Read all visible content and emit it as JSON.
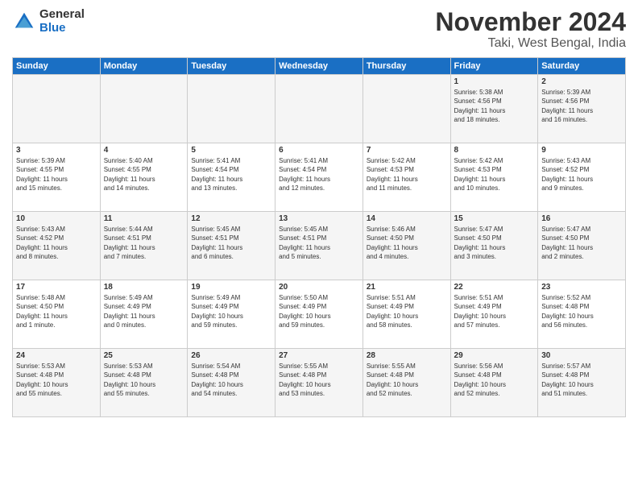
{
  "header": {
    "logo_general": "General",
    "logo_blue": "Blue",
    "month": "November 2024",
    "location": "Taki, West Bengal, India"
  },
  "days_of_week": [
    "Sunday",
    "Monday",
    "Tuesday",
    "Wednesday",
    "Thursday",
    "Friday",
    "Saturday"
  ],
  "weeks": [
    {
      "cells": [
        {
          "day": null,
          "info": null
        },
        {
          "day": null,
          "info": null
        },
        {
          "day": null,
          "info": null
        },
        {
          "day": null,
          "info": null
        },
        {
          "day": null,
          "info": null
        },
        {
          "day": "1",
          "info": "Sunrise: 5:38 AM\nSunset: 4:56 PM\nDaylight: 11 hours\nand 18 minutes."
        },
        {
          "day": "2",
          "info": "Sunrise: 5:39 AM\nSunset: 4:56 PM\nDaylight: 11 hours\nand 16 minutes."
        }
      ]
    },
    {
      "cells": [
        {
          "day": "3",
          "info": "Sunrise: 5:39 AM\nSunset: 4:55 PM\nDaylight: 11 hours\nand 15 minutes."
        },
        {
          "day": "4",
          "info": "Sunrise: 5:40 AM\nSunset: 4:55 PM\nDaylight: 11 hours\nand 14 minutes."
        },
        {
          "day": "5",
          "info": "Sunrise: 5:41 AM\nSunset: 4:54 PM\nDaylight: 11 hours\nand 13 minutes."
        },
        {
          "day": "6",
          "info": "Sunrise: 5:41 AM\nSunset: 4:54 PM\nDaylight: 11 hours\nand 12 minutes."
        },
        {
          "day": "7",
          "info": "Sunrise: 5:42 AM\nSunset: 4:53 PM\nDaylight: 11 hours\nand 11 minutes."
        },
        {
          "day": "8",
          "info": "Sunrise: 5:42 AM\nSunset: 4:53 PM\nDaylight: 11 hours\nand 10 minutes."
        },
        {
          "day": "9",
          "info": "Sunrise: 5:43 AM\nSunset: 4:52 PM\nDaylight: 11 hours\nand 9 minutes."
        }
      ]
    },
    {
      "cells": [
        {
          "day": "10",
          "info": "Sunrise: 5:43 AM\nSunset: 4:52 PM\nDaylight: 11 hours\nand 8 minutes."
        },
        {
          "day": "11",
          "info": "Sunrise: 5:44 AM\nSunset: 4:51 PM\nDaylight: 11 hours\nand 7 minutes."
        },
        {
          "day": "12",
          "info": "Sunrise: 5:45 AM\nSunset: 4:51 PM\nDaylight: 11 hours\nand 6 minutes."
        },
        {
          "day": "13",
          "info": "Sunrise: 5:45 AM\nSunset: 4:51 PM\nDaylight: 11 hours\nand 5 minutes."
        },
        {
          "day": "14",
          "info": "Sunrise: 5:46 AM\nSunset: 4:50 PM\nDaylight: 11 hours\nand 4 minutes."
        },
        {
          "day": "15",
          "info": "Sunrise: 5:47 AM\nSunset: 4:50 PM\nDaylight: 11 hours\nand 3 minutes."
        },
        {
          "day": "16",
          "info": "Sunrise: 5:47 AM\nSunset: 4:50 PM\nDaylight: 11 hours\nand 2 minutes."
        }
      ]
    },
    {
      "cells": [
        {
          "day": "17",
          "info": "Sunrise: 5:48 AM\nSunset: 4:50 PM\nDaylight: 11 hours\nand 1 minute."
        },
        {
          "day": "18",
          "info": "Sunrise: 5:49 AM\nSunset: 4:49 PM\nDaylight: 11 hours\nand 0 minutes."
        },
        {
          "day": "19",
          "info": "Sunrise: 5:49 AM\nSunset: 4:49 PM\nDaylight: 10 hours\nand 59 minutes."
        },
        {
          "day": "20",
          "info": "Sunrise: 5:50 AM\nSunset: 4:49 PM\nDaylight: 10 hours\nand 59 minutes."
        },
        {
          "day": "21",
          "info": "Sunrise: 5:51 AM\nSunset: 4:49 PM\nDaylight: 10 hours\nand 58 minutes."
        },
        {
          "day": "22",
          "info": "Sunrise: 5:51 AM\nSunset: 4:49 PM\nDaylight: 10 hours\nand 57 minutes."
        },
        {
          "day": "23",
          "info": "Sunrise: 5:52 AM\nSunset: 4:48 PM\nDaylight: 10 hours\nand 56 minutes."
        }
      ]
    },
    {
      "cells": [
        {
          "day": "24",
          "info": "Sunrise: 5:53 AM\nSunset: 4:48 PM\nDaylight: 10 hours\nand 55 minutes."
        },
        {
          "day": "25",
          "info": "Sunrise: 5:53 AM\nSunset: 4:48 PM\nDaylight: 10 hours\nand 55 minutes."
        },
        {
          "day": "26",
          "info": "Sunrise: 5:54 AM\nSunset: 4:48 PM\nDaylight: 10 hours\nand 54 minutes."
        },
        {
          "day": "27",
          "info": "Sunrise: 5:55 AM\nSunset: 4:48 PM\nDaylight: 10 hours\nand 53 minutes."
        },
        {
          "day": "28",
          "info": "Sunrise: 5:55 AM\nSunset: 4:48 PM\nDaylight: 10 hours\nand 52 minutes."
        },
        {
          "day": "29",
          "info": "Sunrise: 5:56 AM\nSunset: 4:48 PM\nDaylight: 10 hours\nand 52 minutes."
        },
        {
          "day": "30",
          "info": "Sunrise: 5:57 AM\nSunset: 4:48 PM\nDaylight: 10 hours\nand 51 minutes."
        }
      ]
    }
  ]
}
